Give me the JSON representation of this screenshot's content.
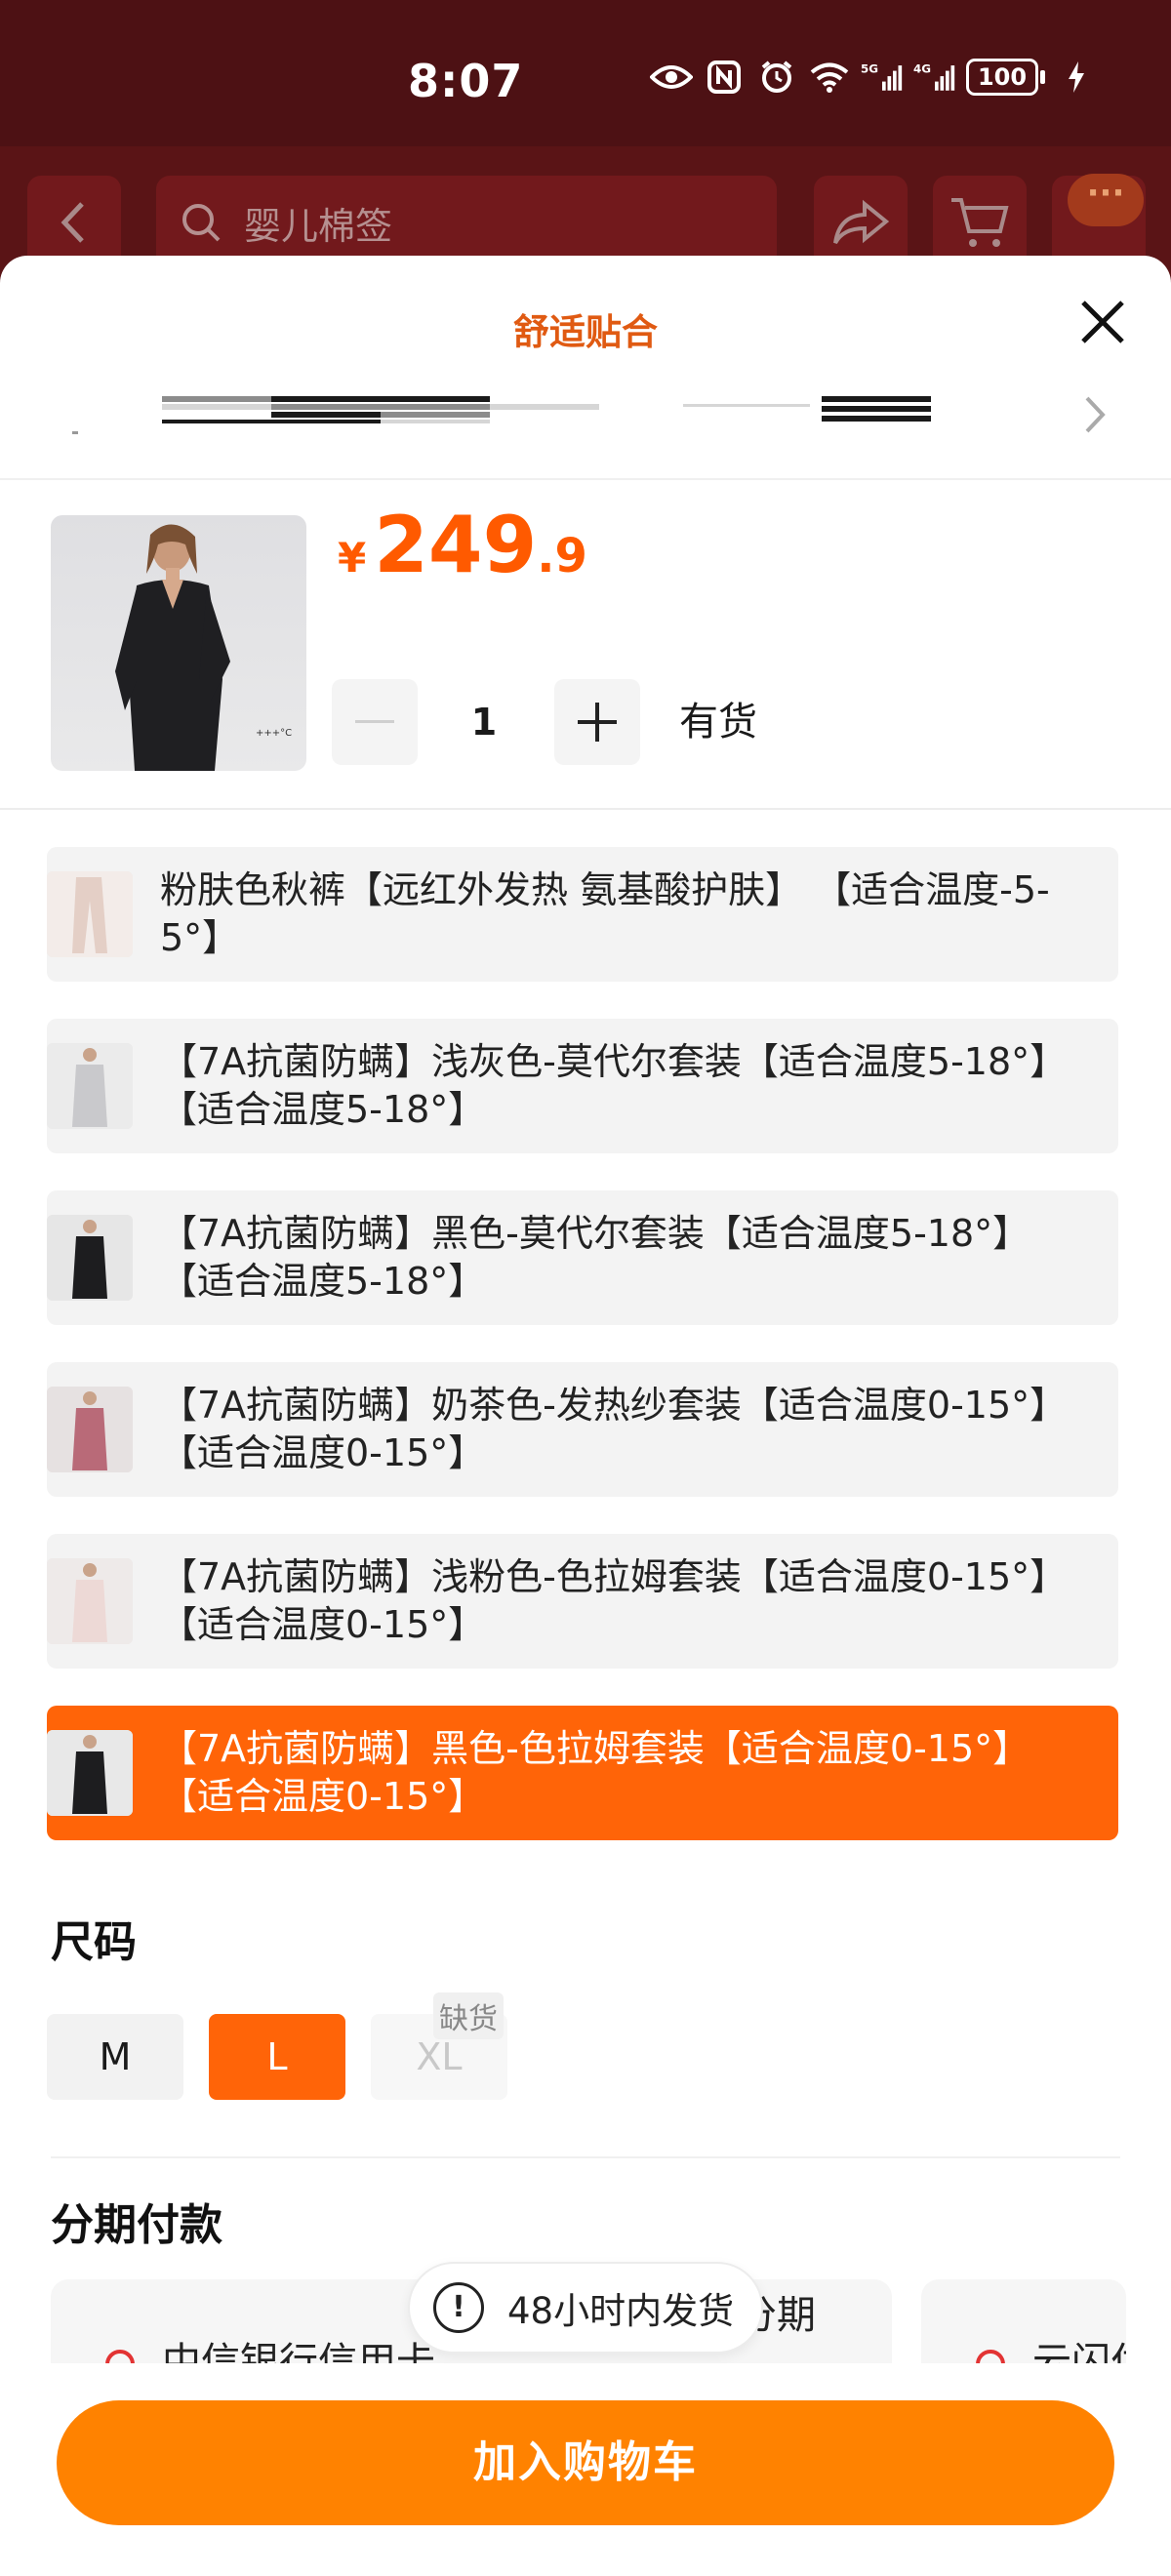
{
  "status_bar": {
    "time": "8:07",
    "battery": "100"
  },
  "header": {
    "search_placeholder": "婴儿棉签",
    "more_label": "···"
  },
  "sheet": {
    "title": "舒适贴合"
  },
  "product": {
    "price_symbol": "¥",
    "price_integer": "249",
    "price_decimal": ".9",
    "quantity": "1",
    "stock_status": "有货",
    "image_caption": "+++°C"
  },
  "variants": [
    {
      "label": "粉肤色秋裤【远红外发热 氨基酸护肤】 【适合温度-5-5°】",
      "selected": false,
      "swatch": "#e4cfc6"
    },
    {
      "label": "【7A抗菌防螨】浅灰色-莫代尔套装【适合温度5-18°】 【适合温度5-18°】",
      "selected": false,
      "swatch": "#c9c9cc"
    },
    {
      "label": "【7A抗菌防螨】黑色-莫代尔套装【适合温度5-18°】 【适合温度5-18°】",
      "selected": false,
      "swatch": "#1d1d1f"
    },
    {
      "label": "【7A抗菌防螨】奶茶色-发热纱套装【适合温度0-15°】 【适合温度0-15°】",
      "selected": false,
      "swatch": "#b96a78"
    },
    {
      "label": "【7A抗菌防螨】浅粉色-色拉姆套装【适合温度0-15°】 【适合温度0-15°】",
      "selected": false,
      "swatch": "#edd9d6"
    },
    {
      "label": "【7A抗菌防螨】黑色-色拉姆套装【适合温度0-15°】 【适合温度0-15°】",
      "selected": true,
      "swatch": "#1d1d1f"
    }
  ],
  "size_section": {
    "title": "尺码",
    "options": [
      {
        "label": "M",
        "state": "normal"
      },
      {
        "label": "L",
        "state": "selected"
      },
      {
        "label": "XL",
        "state": "disabled",
        "tag": "缺货"
      }
    ]
  },
  "installment_section": {
    "title": "分期付款",
    "plans": [
      {
        "label": "中信银行信用卡"
      },
      {
        "label": "花呗分期"
      },
      {
        "label": "云闪付"
      }
    ]
  },
  "toast": {
    "text": "48小时内发货",
    "icon": "!"
  },
  "add_to_cart_label": "加入购物车",
  "colors": {
    "accent": "#ff6408",
    "cta": "#ff8200",
    "title": "#e05a12",
    "header_bg": "#5a1416"
  }
}
